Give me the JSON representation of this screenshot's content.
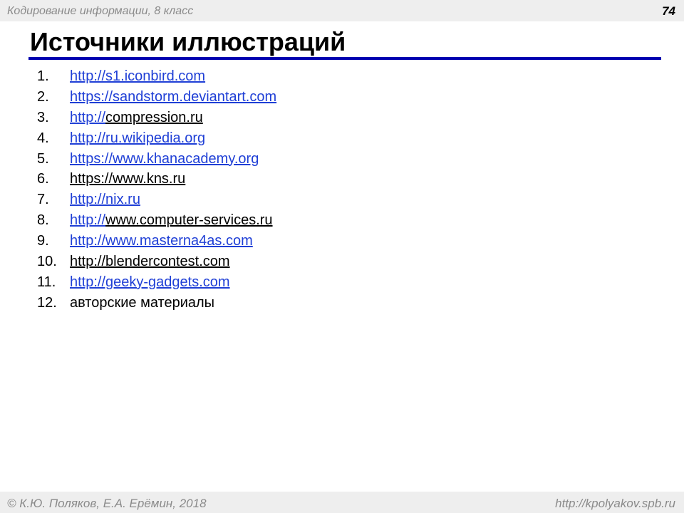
{
  "header": {
    "course": "Кодирование информации, 8 класс",
    "page_number": "74"
  },
  "title": "Источники иллюстраций",
  "colors": {
    "accent_rule": "#0000b0",
    "link": "#1f3fd6",
    "bar_background": "#eeeeee"
  },
  "sources": [
    {
      "num": "1.",
      "parts": [
        {
          "text": "http://s1.iconbird.com",
          "style": "link"
        }
      ]
    },
    {
      "num": "2.",
      "parts": [
        {
          "text": "https://sandstorm.deviantart.com",
          "style": "link"
        }
      ]
    },
    {
      "num": "3.",
      "parts": [
        {
          "text": "http://",
          "style": "link"
        },
        {
          "text": "compression.ru",
          "style": "plain-link"
        }
      ]
    },
    {
      "num": "4.",
      "parts": [
        {
          "text": "http://ru.wikipedia.org",
          "style": "link"
        }
      ]
    },
    {
      "num": "5.",
      "parts": [
        {
          "text": "https://www.khanacademy.org",
          "style": "link"
        }
      ]
    },
    {
      "num": "6.",
      "parts": [
        {
          "text": "https://www.kns.ru",
          "style": "plain-link"
        }
      ]
    },
    {
      "num": "7.",
      "parts": [
        {
          "text": "http://nix.ru",
          "style": "link"
        }
      ]
    },
    {
      "num": "8.",
      "parts": [
        {
          "text": "http://",
          "style": "link"
        },
        {
          "text": "www.computer-services.ru",
          "style": "plain-link"
        }
      ]
    },
    {
      "num": "9.",
      "parts": [
        {
          "text": "http://www.masterna4as.com",
          "style": "link"
        }
      ]
    },
    {
      "num": "10.",
      "parts": [
        {
          "text": "http://blendercontest.com",
          "style": "plain-link"
        }
      ]
    },
    {
      "num": "11.",
      "parts": [
        {
          "text": "http://geeky-gadgets.com",
          "style": "link"
        }
      ]
    },
    {
      "num": "12.",
      "parts": [
        {
          "text": "авторские материалы",
          "style": "plain"
        }
      ]
    }
  ],
  "footer": {
    "copyright_symbol": "©",
    "authors": "К.Ю. Поляков, Е.А. Ерёмин, 2018",
    "site": "http://kpolyakov.spb.ru"
  }
}
